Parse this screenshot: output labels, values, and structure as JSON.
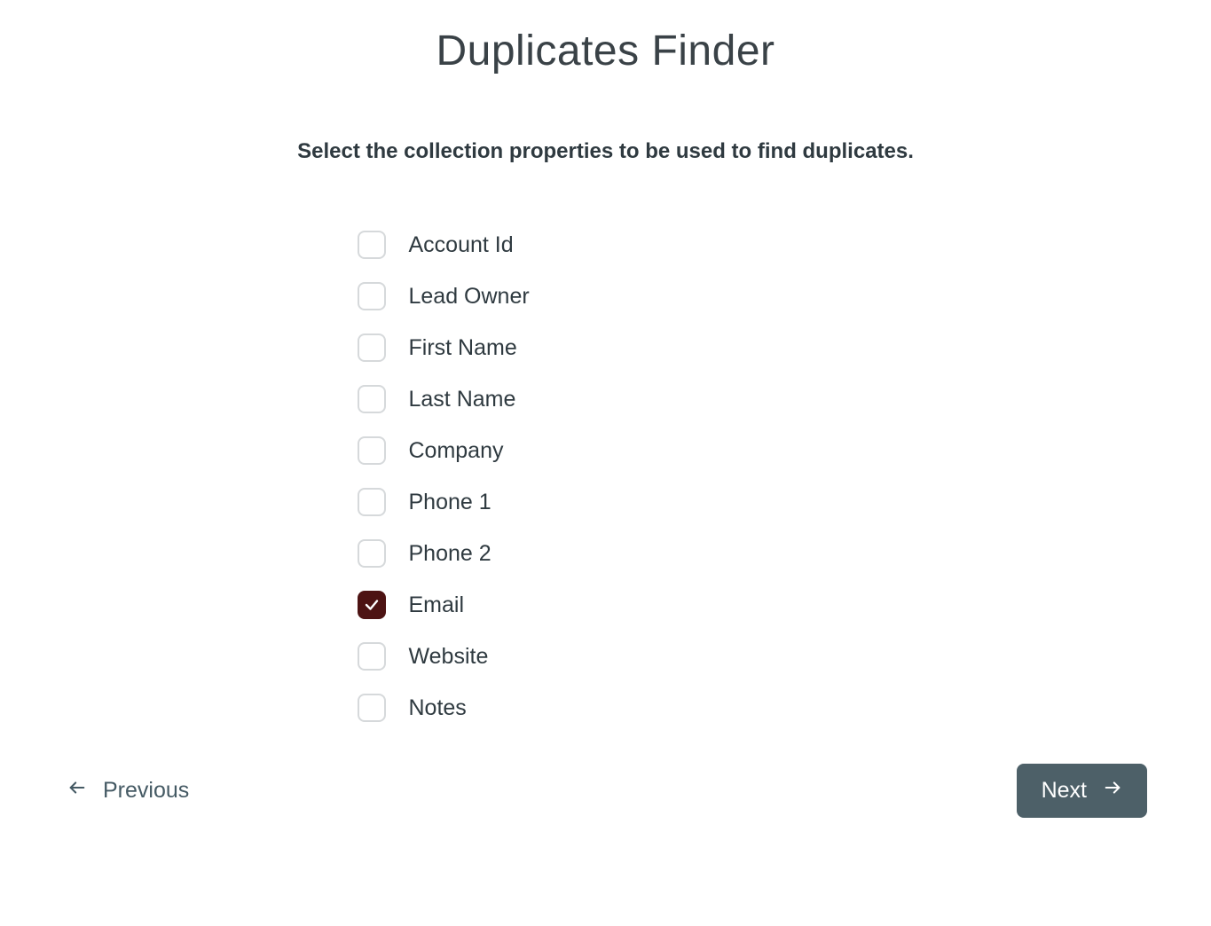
{
  "title": "Duplicates Finder",
  "subtitle": "Select the collection properties to be used to find duplicates.",
  "properties": [
    {
      "label": "Account Id",
      "checked": false
    },
    {
      "label": "Lead Owner",
      "checked": false
    },
    {
      "label": "First Name",
      "checked": false
    },
    {
      "label": "Last Name",
      "checked": false
    },
    {
      "label": "Company",
      "checked": false
    },
    {
      "label": "Phone 1",
      "checked": false
    },
    {
      "label": "Phone 2",
      "checked": false
    },
    {
      "label": "Email",
      "checked": true
    },
    {
      "label": "Website",
      "checked": false
    },
    {
      "label": "Notes",
      "checked": false
    }
  ],
  "nav": {
    "prev_label": "Previous",
    "next_label": "Next"
  },
  "colors": {
    "checkbox_checked_bg": "#4d1313",
    "next_button_bg": "#4d6068",
    "text_primary": "#2f3a40",
    "text_secondary": "#455a64"
  }
}
